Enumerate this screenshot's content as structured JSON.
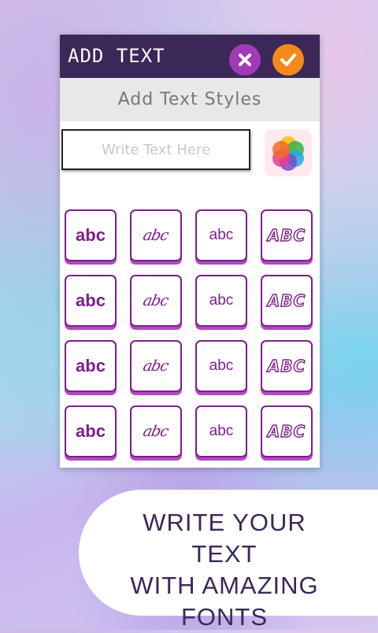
{
  "header": {
    "title": "ADD TEXT"
  },
  "section": {
    "title": "Add Text Styles"
  },
  "input": {
    "placeholder": "Write Text Here",
    "value": ""
  },
  "font_styles": [
    {
      "sample": "abc",
      "style": "bold"
    },
    {
      "sample": "abc",
      "style": "script"
    },
    {
      "sample": "abc",
      "style": "plain"
    },
    {
      "sample": "ABC",
      "style": "block"
    },
    {
      "sample": "abc",
      "style": "bold"
    },
    {
      "sample": "abc",
      "style": "script"
    },
    {
      "sample": "abc",
      "style": "plain"
    },
    {
      "sample": "ABC",
      "style": "block"
    },
    {
      "sample": "abc",
      "style": "bold"
    },
    {
      "sample": "abc",
      "style": "script"
    },
    {
      "sample": "abc",
      "style": "plain"
    },
    {
      "sample": "ABC",
      "style": "block"
    },
    {
      "sample": "abc",
      "style": "bold"
    },
    {
      "sample": "abc",
      "style": "script"
    },
    {
      "sample": "abc",
      "style": "plain"
    },
    {
      "sample": "ABC",
      "style": "block"
    }
  ],
  "banner": {
    "lines": [
      "WRITE YOUR TEXT",
      "WITH AMAZING",
      "FONTS"
    ]
  },
  "colors": {
    "header_bg": "#3b2758",
    "close_button": "#a03ab7",
    "confirm_button": "#f38a1b",
    "font_accent": "#7c1f8a"
  },
  "icons": {
    "close": "close-icon",
    "confirm": "check-icon",
    "color_picker": "color-wheel-icon"
  }
}
